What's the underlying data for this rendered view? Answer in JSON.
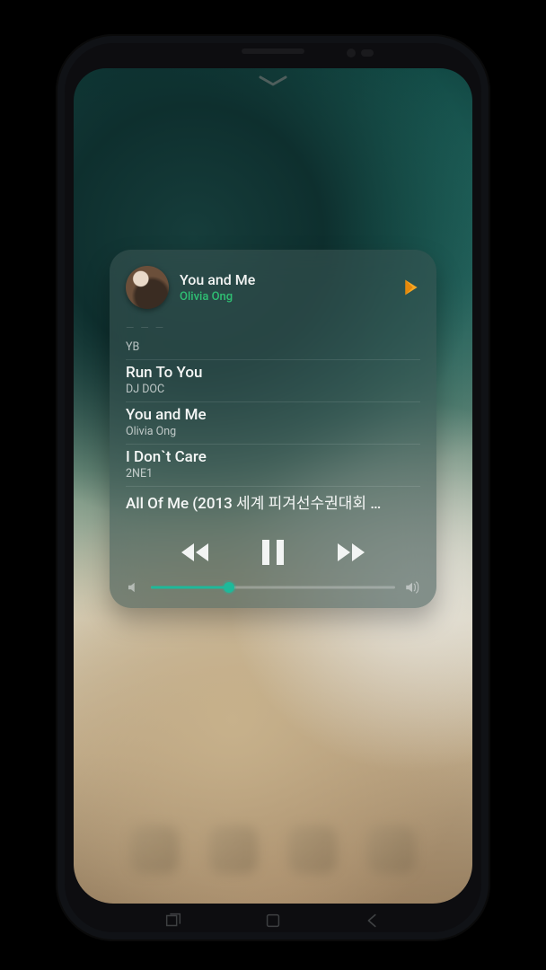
{
  "colors": {
    "accent": "#1eb99a",
    "artist_highlight": "#2fbf73"
  },
  "now_playing": {
    "title": "You and Me",
    "artist": "Olivia Ong",
    "source_icon": "google-play-music-icon"
  },
  "playlist_truncated_top": "— — —",
  "playlist": [
    {
      "title": "",
      "artist": "YB"
    },
    {
      "title": "Run To You",
      "artist": "DJ DOC"
    },
    {
      "title": "You and Me",
      "artist": "Olivia Ong"
    },
    {
      "title": "I Don`t Care",
      "artist": "2NE1"
    },
    {
      "title": "All Of Me (2013 세계 피겨선수권대회 …",
      "artist": ""
    }
  ],
  "controls": {
    "prev": "previous",
    "playpause": "pause",
    "next": "next"
  },
  "volume": {
    "percent": 32
  }
}
